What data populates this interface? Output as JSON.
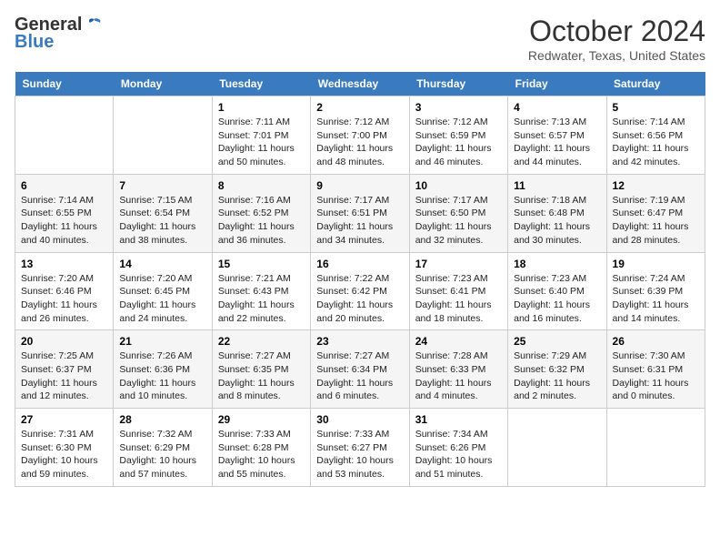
{
  "header": {
    "logo_line1": "General",
    "logo_line2": "Blue",
    "month_title": "October 2024",
    "location": "Redwater, Texas, United States"
  },
  "days_of_week": [
    "Sunday",
    "Monday",
    "Tuesday",
    "Wednesday",
    "Thursday",
    "Friday",
    "Saturday"
  ],
  "weeks": [
    [
      {
        "day": "",
        "info": ""
      },
      {
        "day": "",
        "info": ""
      },
      {
        "day": "1",
        "info": "Sunrise: 7:11 AM\nSunset: 7:01 PM\nDaylight: 11 hours and 50 minutes."
      },
      {
        "day": "2",
        "info": "Sunrise: 7:12 AM\nSunset: 7:00 PM\nDaylight: 11 hours and 48 minutes."
      },
      {
        "day": "3",
        "info": "Sunrise: 7:12 AM\nSunset: 6:59 PM\nDaylight: 11 hours and 46 minutes."
      },
      {
        "day": "4",
        "info": "Sunrise: 7:13 AM\nSunset: 6:57 PM\nDaylight: 11 hours and 44 minutes."
      },
      {
        "day": "5",
        "info": "Sunrise: 7:14 AM\nSunset: 6:56 PM\nDaylight: 11 hours and 42 minutes."
      }
    ],
    [
      {
        "day": "6",
        "info": "Sunrise: 7:14 AM\nSunset: 6:55 PM\nDaylight: 11 hours and 40 minutes."
      },
      {
        "day": "7",
        "info": "Sunrise: 7:15 AM\nSunset: 6:54 PM\nDaylight: 11 hours and 38 minutes."
      },
      {
        "day": "8",
        "info": "Sunrise: 7:16 AM\nSunset: 6:52 PM\nDaylight: 11 hours and 36 minutes."
      },
      {
        "day": "9",
        "info": "Sunrise: 7:17 AM\nSunset: 6:51 PM\nDaylight: 11 hours and 34 minutes."
      },
      {
        "day": "10",
        "info": "Sunrise: 7:17 AM\nSunset: 6:50 PM\nDaylight: 11 hours and 32 minutes."
      },
      {
        "day": "11",
        "info": "Sunrise: 7:18 AM\nSunset: 6:48 PM\nDaylight: 11 hours and 30 minutes."
      },
      {
        "day": "12",
        "info": "Sunrise: 7:19 AM\nSunset: 6:47 PM\nDaylight: 11 hours and 28 minutes."
      }
    ],
    [
      {
        "day": "13",
        "info": "Sunrise: 7:20 AM\nSunset: 6:46 PM\nDaylight: 11 hours and 26 minutes."
      },
      {
        "day": "14",
        "info": "Sunrise: 7:20 AM\nSunset: 6:45 PM\nDaylight: 11 hours and 24 minutes."
      },
      {
        "day": "15",
        "info": "Sunrise: 7:21 AM\nSunset: 6:43 PM\nDaylight: 11 hours and 22 minutes."
      },
      {
        "day": "16",
        "info": "Sunrise: 7:22 AM\nSunset: 6:42 PM\nDaylight: 11 hours and 20 minutes."
      },
      {
        "day": "17",
        "info": "Sunrise: 7:23 AM\nSunset: 6:41 PM\nDaylight: 11 hours and 18 minutes."
      },
      {
        "day": "18",
        "info": "Sunrise: 7:23 AM\nSunset: 6:40 PM\nDaylight: 11 hours and 16 minutes."
      },
      {
        "day": "19",
        "info": "Sunrise: 7:24 AM\nSunset: 6:39 PM\nDaylight: 11 hours and 14 minutes."
      }
    ],
    [
      {
        "day": "20",
        "info": "Sunrise: 7:25 AM\nSunset: 6:37 PM\nDaylight: 11 hours and 12 minutes."
      },
      {
        "day": "21",
        "info": "Sunrise: 7:26 AM\nSunset: 6:36 PM\nDaylight: 11 hours and 10 minutes."
      },
      {
        "day": "22",
        "info": "Sunrise: 7:27 AM\nSunset: 6:35 PM\nDaylight: 11 hours and 8 minutes."
      },
      {
        "day": "23",
        "info": "Sunrise: 7:27 AM\nSunset: 6:34 PM\nDaylight: 11 hours and 6 minutes."
      },
      {
        "day": "24",
        "info": "Sunrise: 7:28 AM\nSunset: 6:33 PM\nDaylight: 11 hours and 4 minutes."
      },
      {
        "day": "25",
        "info": "Sunrise: 7:29 AM\nSunset: 6:32 PM\nDaylight: 11 hours and 2 minutes."
      },
      {
        "day": "26",
        "info": "Sunrise: 7:30 AM\nSunset: 6:31 PM\nDaylight: 11 hours and 0 minutes."
      }
    ],
    [
      {
        "day": "27",
        "info": "Sunrise: 7:31 AM\nSunset: 6:30 PM\nDaylight: 10 hours and 59 minutes."
      },
      {
        "day": "28",
        "info": "Sunrise: 7:32 AM\nSunset: 6:29 PM\nDaylight: 10 hours and 57 minutes."
      },
      {
        "day": "29",
        "info": "Sunrise: 7:33 AM\nSunset: 6:28 PM\nDaylight: 10 hours and 55 minutes."
      },
      {
        "day": "30",
        "info": "Sunrise: 7:33 AM\nSunset: 6:27 PM\nDaylight: 10 hours and 53 minutes."
      },
      {
        "day": "31",
        "info": "Sunrise: 7:34 AM\nSunset: 6:26 PM\nDaylight: 10 hours and 51 minutes."
      },
      {
        "day": "",
        "info": ""
      },
      {
        "day": "",
        "info": ""
      }
    ]
  ]
}
